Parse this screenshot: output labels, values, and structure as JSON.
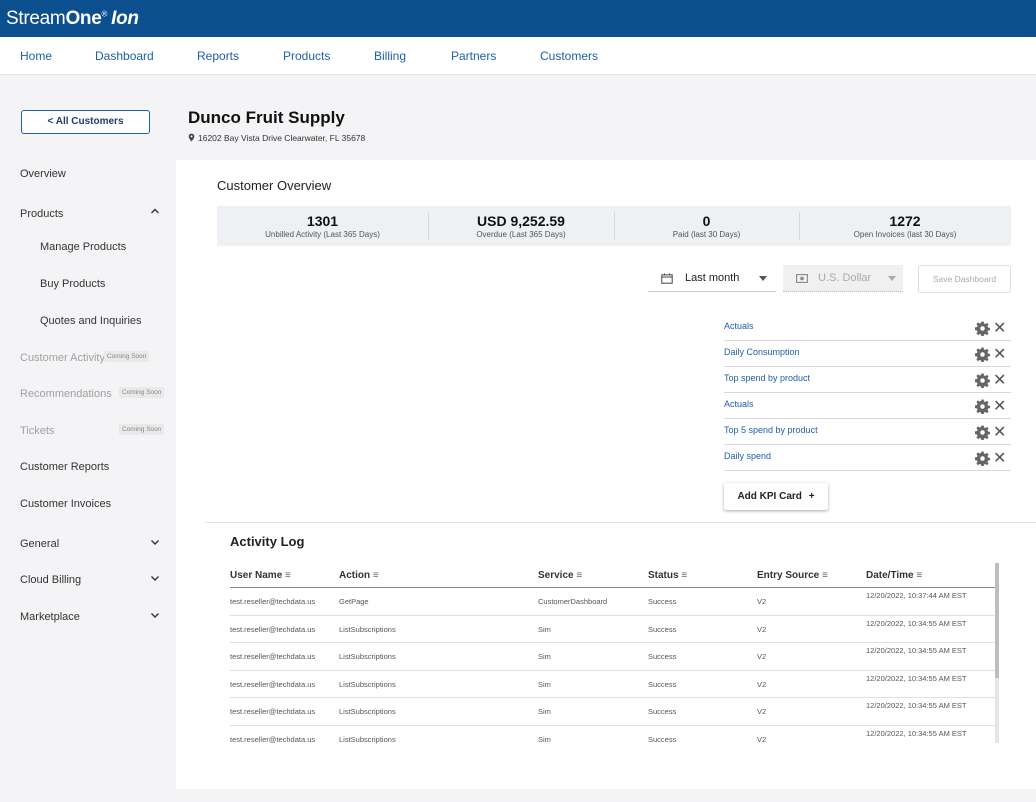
{
  "brand": {
    "part1": "Stream",
    "part2": "One",
    "reg": "®",
    "part3": "Ion"
  },
  "nav": {
    "items": [
      "Home",
      "Dashboard",
      "Reports",
      "Products",
      "Billing",
      "Partners",
      "Customers"
    ]
  },
  "sidebar": {
    "back_label": "< All Customers",
    "overview": "Overview",
    "products": "Products",
    "manage_products": "Manage Products",
    "buy_products": "Buy Products",
    "quotes": "Quotes and Inquiries",
    "customer_activity": "Customer Activity",
    "recommendations": "Recommendations",
    "tickets": "Tickets",
    "coming_soon": "Coming Soon",
    "customer_reports": "Customer Reports",
    "customer_invoices": "Customer Invoices",
    "general": "General",
    "cloud_billing": "Cloud Billing",
    "marketplace": "Marketplace"
  },
  "customer": {
    "name": "Dunco Fruit Supply",
    "address": "16202 Bay Vista Drive Clearwater, FL 35678"
  },
  "overview": {
    "title": "Customer Overview",
    "stats": [
      {
        "value": "1301",
        "label": "Unbilled Activity (Last 365 Days)"
      },
      {
        "value": "USD 9,252.59",
        "label": "Overdue (Last 365 Days)"
      },
      {
        "value": "0",
        "label": "Paid (last 30 Days)"
      },
      {
        "value": "1272",
        "label": "Open Invoices (last 30 Days)"
      }
    ]
  },
  "filters": {
    "period": "Last month",
    "currency": "U.S. Dollar",
    "save_label": "Save Dashboard"
  },
  "kpis": {
    "items": [
      "Actuals",
      "Daily Consumption",
      "Top spend by product",
      "Actuals",
      "Top 5 spend by product",
      "Daily spend"
    ],
    "add_label": "Add KPI Card"
  },
  "activity_log": {
    "title": "Activity Log",
    "columns": [
      "User Name",
      "Action",
      "Service",
      "Status",
      "Entry Source",
      "Date/Time"
    ],
    "rows": [
      [
        "test.reseller@techdata.us",
        "GetPage",
        "CustomerDashboard",
        "Success",
        "V2",
        "12/20/2022, 10:37:44 AM EST"
      ],
      [
        "test.reseller@techdata.us",
        "ListSubscriptions",
        "Sim",
        "Success",
        "V2",
        "12/20/2022, 10:34:55 AM EST"
      ],
      [
        "test.reseller@techdata.us",
        "ListSubscriptions",
        "Sim",
        "Success",
        "V2",
        "12/20/2022, 10:34:55 AM EST"
      ],
      [
        "test.reseller@techdata.us",
        "ListSubscriptions",
        "Sim",
        "Success",
        "V2",
        "12/20/2022, 10:34:55 AM EST"
      ],
      [
        "test.reseller@techdata.us",
        "ListSubscriptions",
        "Sim",
        "Success",
        "V2",
        "12/20/2022, 10:34:55 AM EST"
      ],
      [
        "test.reseller@techdata.us",
        "ListSubscriptions",
        "Sim",
        "Success",
        "V2",
        "12/20/2022, 10:34:55 AM EST"
      ]
    ]
  },
  "colors": {
    "brand_blue": "#0b4f8f",
    "link_blue": "#1f5fa8"
  }
}
